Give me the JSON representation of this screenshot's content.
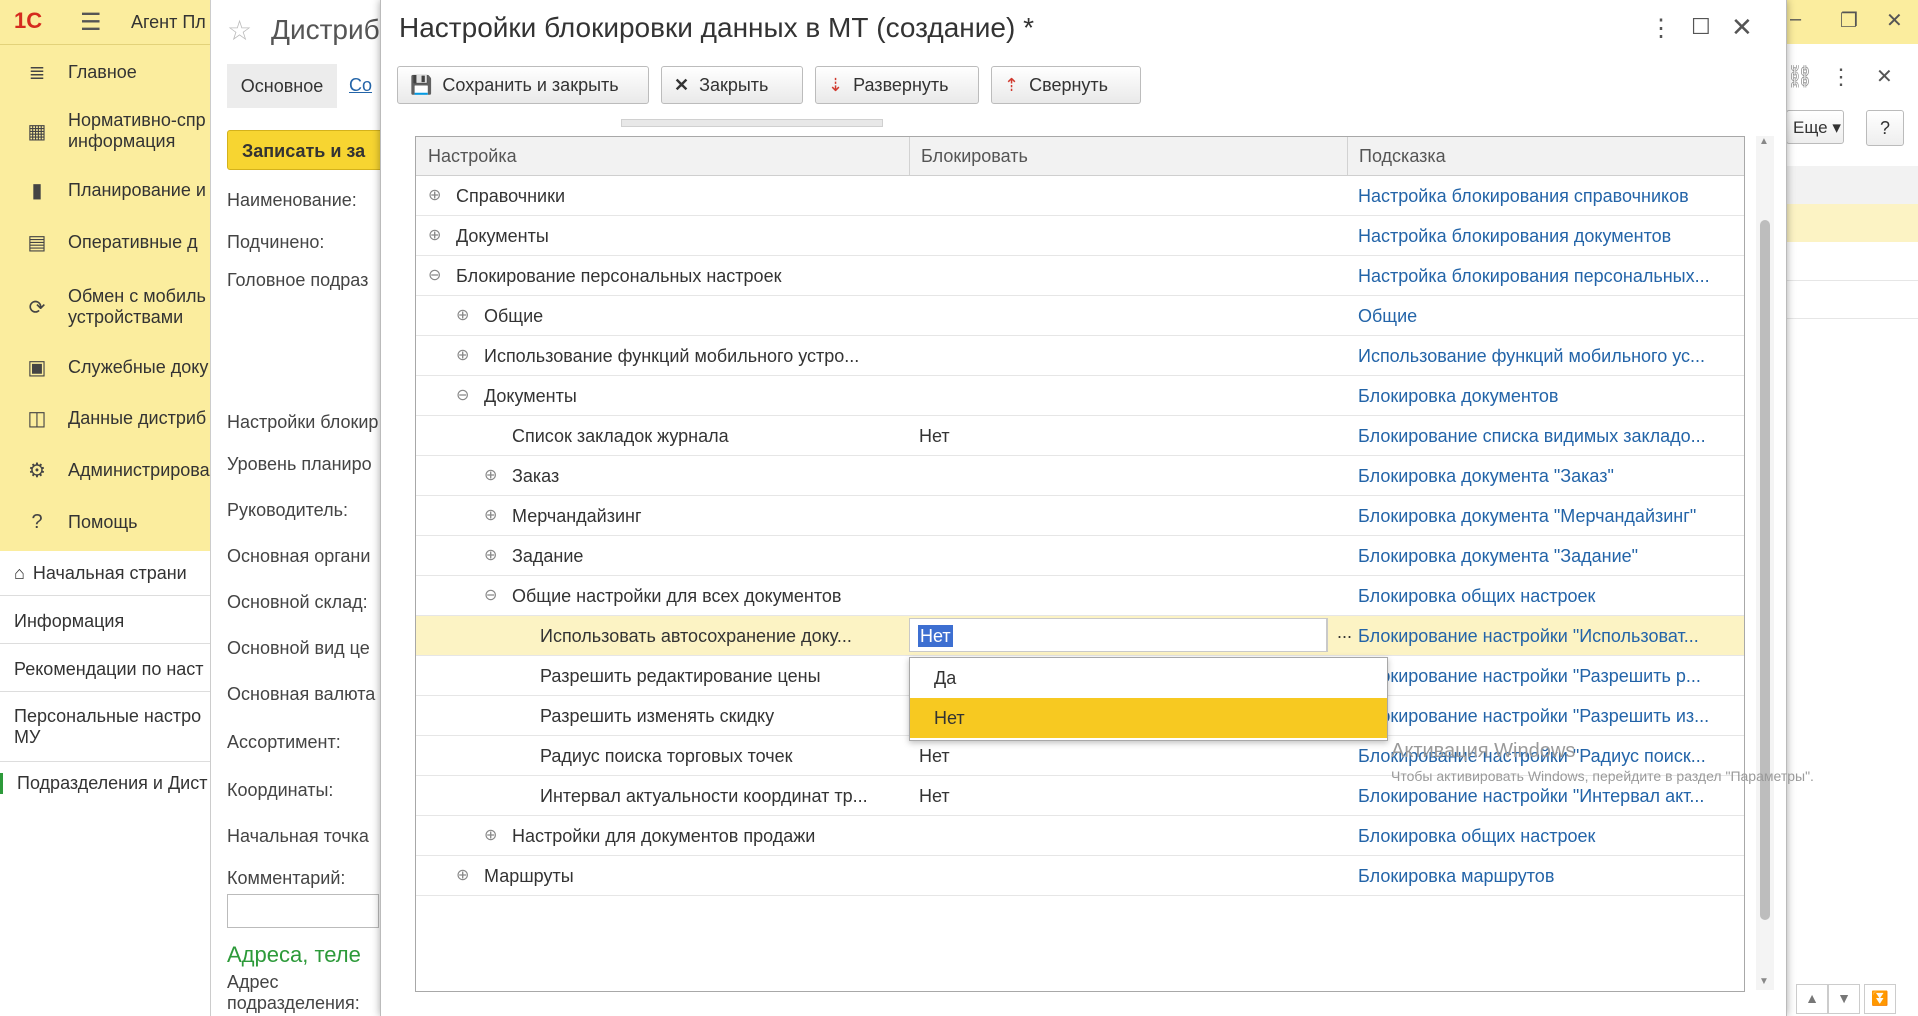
{
  "appbar": {
    "logo": "1С",
    "app_name": "Агент Пл"
  },
  "sidebar": {
    "items": [
      {
        "label": "Главное"
      },
      {
        "label": "Нормативно-спр\nинформация"
      },
      {
        "label": "Планирование и"
      },
      {
        "label": "Оперативные д"
      },
      {
        "label": "Обмен с мобиль\nустройствами"
      },
      {
        "label": "Служебные доку"
      },
      {
        "label": "Данные дистриб"
      },
      {
        "label": "Администрирова"
      },
      {
        "label": "Помощь"
      }
    ]
  },
  "open_list": {
    "items": [
      {
        "label": "Начальная страни"
      },
      {
        "label": "Информация"
      },
      {
        "label": "Рекомендации по наст"
      },
      {
        "label": "Персональные настро\nМУ"
      },
      {
        "label": "Подразделения и Дист"
      }
    ]
  },
  "bg_form": {
    "title": "Дистриб",
    "tab_main": "Основное",
    "tab_other": "Со",
    "save_button": "Записать и за",
    "labels": [
      "Наименование:",
      "Подчинено:",
      "Головное подраз",
      "Настройки блокир",
      "Уровень планиро",
      "Руководитель:",
      "Основная органи",
      "Основной склад:",
      "Основной вид це",
      "Основная валюта",
      "Ассортимент:",
      "Координаты:",
      "Начальная точка",
      "Комментарий:"
    ],
    "section_title": "Адреса, теле",
    "address_label": "Адрес\nподразделения:"
  },
  "bg_right": {
    "more_button": "Еще",
    "help_button": "?"
  },
  "modal": {
    "title": "Настройки блокировки данных в МТ (создание) *",
    "toolbar": {
      "save_close": "Сохранить и закрыть",
      "close": "Закрыть",
      "expand": "Развернуть",
      "collapse": "Свернуть"
    },
    "columns": [
      "Настройка",
      "Блокировать",
      "Подсказка"
    ],
    "rows": [
      {
        "name": "Справочники",
        "expander": "⊕",
        "value": "",
        "hint": "Настройка блокирования справочников"
      },
      {
        "name": "Документы",
        "expander": "⊕",
        "value": "",
        "hint": "Настройка блокирования документов"
      },
      {
        "name": "Блокирование персональных настроек",
        "expander": "⊖",
        "value": "",
        "hint": "Настройка блокирования персональных..."
      },
      {
        "name": "Общие",
        "expander": "⊕",
        "value": "",
        "hint": "Общие"
      },
      {
        "name": "Использование функций мобильного устро...",
        "expander": "⊕",
        "value": "",
        "hint": "Использование функций мобильного ус..."
      },
      {
        "name": "Документы",
        "expander": "⊖",
        "value": "",
        "hint": "Блокировка документов"
      },
      {
        "name": "Список закладок журнала",
        "expander": "",
        "value": "Нет",
        "hint": "Блокирование списка видимых закладо..."
      },
      {
        "name": "Заказ",
        "expander": "⊕",
        "value": "",
        "hint": "Блокировка документа \"Заказ\""
      },
      {
        "name": "Мерчандайзинг",
        "expander": "⊕",
        "value": "",
        "hint": "Блокировка документа \"Мерчандайзинг\""
      },
      {
        "name": "Задание",
        "expander": "⊕",
        "value": "",
        "hint": "Блокировка документа \"Задание\""
      },
      {
        "name": "Общие настройки для всех документов",
        "expander": "⊖",
        "value": "",
        "hint": "Блокировка общих настроек"
      },
      {
        "name": "Использовать автосохранение доку...",
        "expander": "",
        "value": "Нет",
        "hint": "Блокирование настройки \"Использоват..."
      },
      {
        "name": "Разрешить редактирование цены",
        "expander": "",
        "value": "",
        "hint": "Блокирование настройки \"Разрешить р..."
      },
      {
        "name": "Разрешить изменять скидку",
        "expander": "",
        "value": "",
        "hint": "Блокирование настройки \"Разрешить из..."
      },
      {
        "name": "Радиус поиска торговых точек",
        "expander": "",
        "value": "Нет",
        "hint": "Блокирование настройки \"Радиус поиск..."
      },
      {
        "name": "Интервал актуальности координат тр...",
        "expander": "",
        "value": "Нет",
        "hint": "Блокирование настройки \"Интервал акт..."
      },
      {
        "name": "Настройки для документов продажи",
        "expander": "⊕",
        "value": "",
        "hint": "Блокировка общих настроек"
      },
      {
        "name": "Маршруты",
        "expander": "⊕",
        "value": "",
        "hint": "Блокировка маршрутов"
      }
    ],
    "dropdown_options": [
      "Да",
      "Нет"
    ],
    "editor_button": "..."
  },
  "watermark": {
    "line1": "Активация Windows",
    "line2": "Чтобы активировать Windows, перейдите в раздел \"Параметры\"."
  },
  "colors": {
    "sidebar_bg": "#fbed9e",
    "selection": "#fcf3c4",
    "dropdown_active": "#f7c921",
    "link": "#2364a8",
    "save_button_bg": "#f7d531"
  }
}
